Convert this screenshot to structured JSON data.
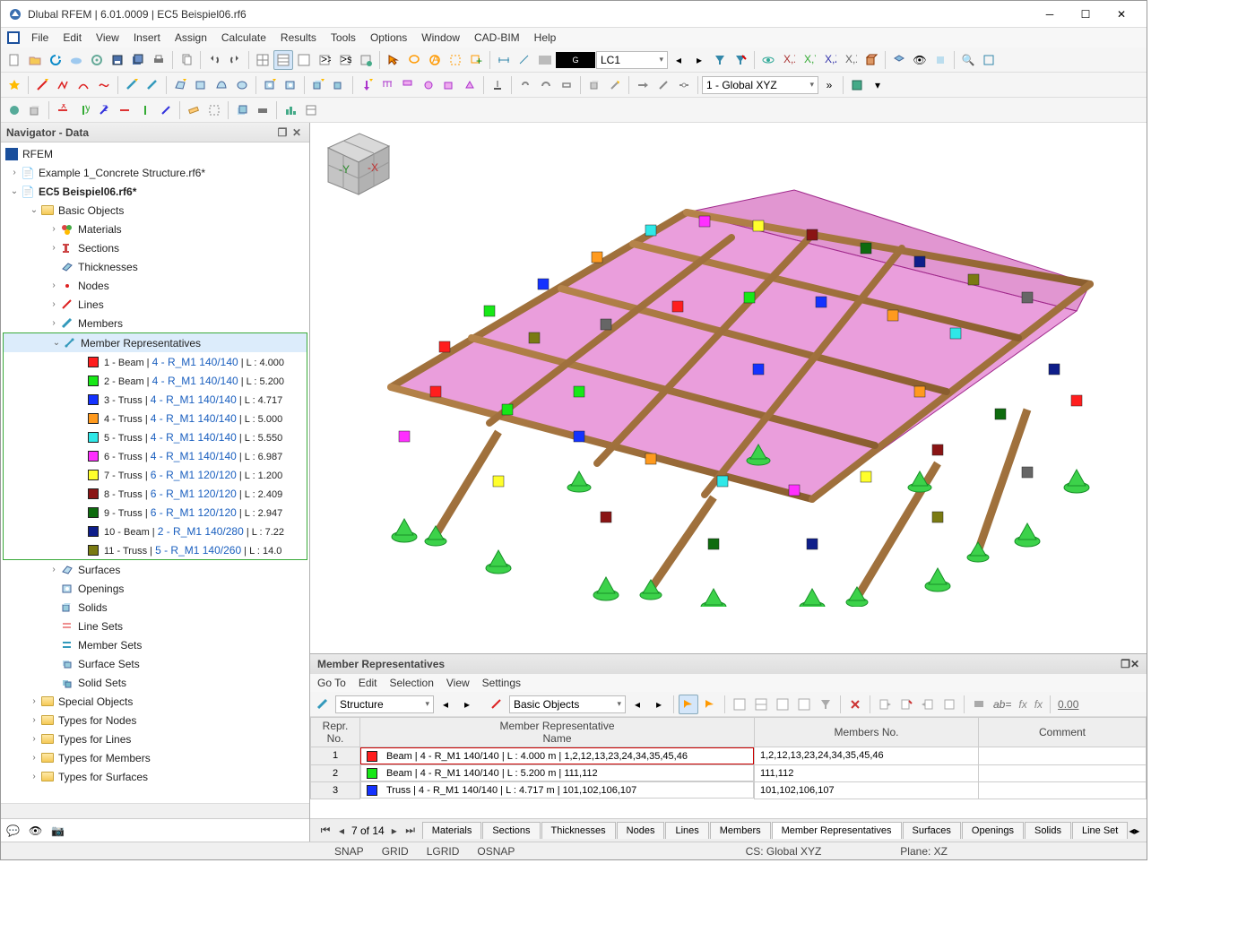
{
  "title": "Dlubal RFEM | 6.01.0009 | EC5 Beispiel06.rf6",
  "menu": [
    "File",
    "Edit",
    "View",
    "Insert",
    "Assign",
    "Calculate",
    "Results",
    "Tools",
    "Options",
    "Window",
    "CAD-BIM",
    "Help"
  ],
  "lcBlack": "G",
  "lcCombo": "LC1",
  "csCombo": "1 - Global XYZ",
  "nav": {
    "title": "Navigator - Data",
    "root": "RFEM",
    "files": [
      "Example 1_Concrete Structure.rf6*",
      "EC5 Beispiel06.rf6*"
    ],
    "basic": "Basic Objects",
    "items": [
      "Materials",
      "Sections",
      "Thicknesses",
      "Nodes",
      "Lines",
      "Members"
    ],
    "memberRepLabel": "Member Representatives",
    "reps": [
      {
        "n": "1",
        "t": "Beam",
        "s": "4 - R_M1 140/140",
        "l": "L : 4.000",
        "c": "#ff1e1e"
      },
      {
        "n": "2",
        "t": "Beam",
        "s": "4 - R_M1 140/140",
        "l": "L : 5.200",
        "c": "#17e817"
      },
      {
        "n": "3",
        "t": "Truss",
        "s": "4 - R_M1 140/140",
        "l": "L : 4.717",
        "c": "#1432ff"
      },
      {
        "n": "4",
        "t": "Truss",
        "s": "4 - R_M1 140/140",
        "l": "L : 5.000",
        "c": "#ff9a1e"
      },
      {
        "n": "5",
        "t": "Truss",
        "s": "4 - R_M1 140/140",
        "l": "L : 5.550",
        "c": "#2fe8e8"
      },
      {
        "n": "6",
        "t": "Truss",
        "s": "4 - R_M1 140/140",
        "l": "L : 6.987",
        "c": "#ff2fff"
      },
      {
        "n": "7",
        "t": "Truss",
        "s": "6 - R_M1 120/120",
        "l": "L : 1.200",
        "c": "#ffff2c"
      },
      {
        "n": "8",
        "t": "Truss",
        "s": "6 - R_M1 120/120",
        "l": "L : 2.409",
        "c": "#8a1414"
      },
      {
        "n": "9",
        "t": "Truss",
        "s": "6 - R_M1 120/120",
        "l": "L : 2.947",
        "c": "#0e6b0e"
      },
      {
        "n": "10",
        "t": "Beam",
        "s": "2 - R_M1 140/280",
        "l": "L : 7.22",
        "c": "#0e1e8a"
      },
      {
        "n": "11",
        "t": "Truss",
        "s": "5 - R_M1 140/260",
        "l": "L : 14.0",
        "c": "#7a7a12"
      }
    ],
    "after": [
      "Surfaces",
      "Openings",
      "Solids",
      "Line Sets",
      "Member Sets",
      "Surface Sets",
      "Solid Sets"
    ],
    "folders": [
      "Special Objects",
      "Types for Nodes",
      "Types for Lines",
      "Types for Members",
      "Types for Surfaces"
    ]
  },
  "bpanel": {
    "title": "Member Representatives",
    "menu": [
      "Go To",
      "Edit",
      "Selection",
      "View",
      "Settings"
    ],
    "combo1": "Structure",
    "combo2": "Basic Objects",
    "headers": {
      "rn": "Repr.\nNo.",
      "name": "Member Representative\nName",
      "members": "Members No.",
      "comment": "Comment"
    },
    "rows": [
      {
        "rn": "1",
        "c": "#ff1e1e",
        "name": "Beam | 4 - R_M1 140/140 | L : 4.000 m | 1,2,12,13,23,24,34,35,45,46",
        "mem": "1,2,12,13,23,24,34,35,45,46"
      },
      {
        "rn": "2",
        "c": "#17e817",
        "name": "Beam | 4 - R_M1 140/140 | L : 5.200 m | 111,112",
        "mem": "111,112"
      },
      {
        "rn": "3",
        "c": "#1432ff",
        "name": "Truss | 4 - R_M1 140/140 | L : 4.717 m | 101,102,106,107",
        "mem": "101,102,106,107"
      }
    ],
    "page": "7 of 14",
    "tabs": [
      "Materials",
      "Sections",
      "Thicknesses",
      "Nodes",
      "Lines",
      "Members",
      "Member Representatives",
      "Surfaces",
      "Openings",
      "Solids",
      "Line Set"
    ]
  },
  "status": {
    "snap": "SNAP",
    "grid": "GRID",
    "lgrid": "LGRID",
    "osnap": "OSNAP",
    "cs": "CS: Global XYZ",
    "plane": "Plane: XZ"
  },
  "cube": {
    "x": "-X",
    "y": "-Y"
  }
}
